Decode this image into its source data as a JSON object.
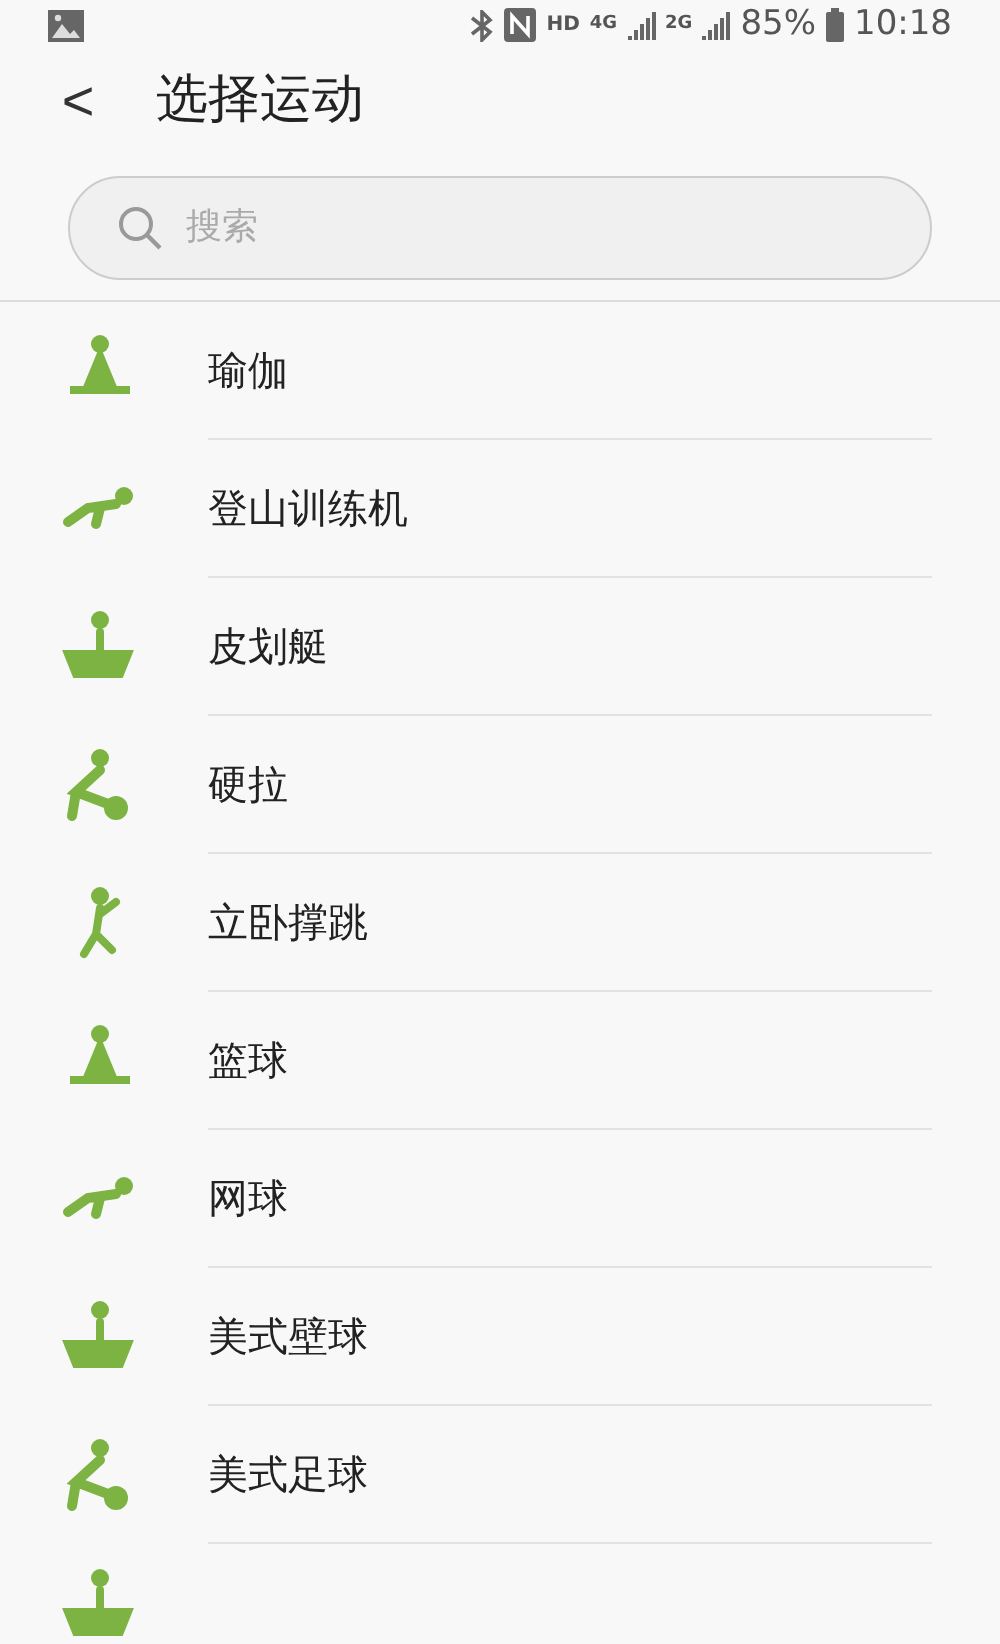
{
  "status_bar": {
    "hd": "HD",
    "net1": "4G",
    "net2": "2G",
    "battery": "85%",
    "time": "10:18"
  },
  "header": {
    "back": "<",
    "title": "选择运动"
  },
  "search": {
    "placeholder": "搜索"
  },
  "items": [
    {
      "label": "瑜伽"
    },
    {
      "label": "登山训练机"
    },
    {
      "label": "皮划艇"
    },
    {
      "label": "硬拉"
    },
    {
      "label": "立卧撑跳"
    },
    {
      "label": "篮球"
    },
    {
      "label": "网球"
    },
    {
      "label": "美式壁球"
    },
    {
      "label": "美式足球"
    }
  ]
}
